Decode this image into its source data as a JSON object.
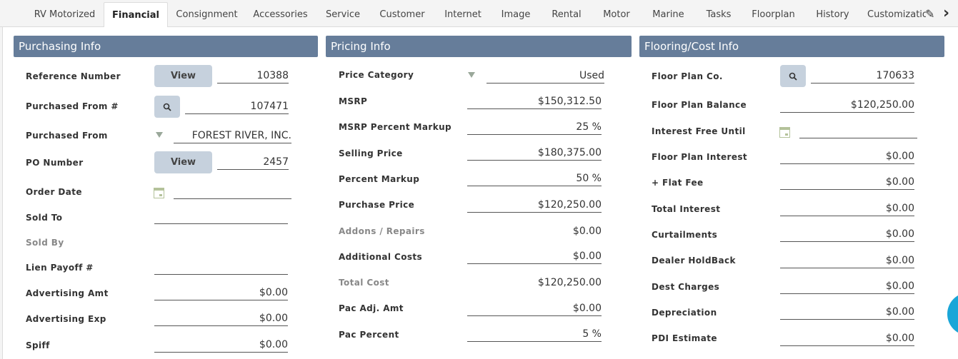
{
  "tabs": [
    {
      "label": "RV Motorized"
    },
    {
      "label": "Financial"
    },
    {
      "label": "Consignment"
    },
    {
      "label": "Accessories"
    },
    {
      "label": "Service"
    },
    {
      "label": "Customer"
    },
    {
      "label": "Internet"
    },
    {
      "label": "Image"
    },
    {
      "label": "Rental"
    },
    {
      "label": "Motor"
    },
    {
      "label": "Marine"
    },
    {
      "label": "Tasks"
    },
    {
      "label": "Floorplan"
    },
    {
      "label": "History"
    },
    {
      "label": "Customization"
    }
  ],
  "tab_tools": {
    "edit_icon": "✎",
    "next_icon": "›"
  },
  "purchasing": {
    "title": "Purchasing Info",
    "reference_number": {
      "label": "Reference Number",
      "button": "View",
      "value": "10388"
    },
    "purchased_from_num": {
      "label": "Purchased From #",
      "button_icon": "search-icon",
      "value": "107471"
    },
    "purchased_from": {
      "label": "Purchased From",
      "value": "FOREST RIVER, INC."
    },
    "po_number": {
      "label": "PO Number",
      "button": "View",
      "value": "2457"
    },
    "order_date": {
      "label": "Order Date",
      "value": ""
    },
    "sold_to": {
      "label": "Sold To",
      "value": ""
    },
    "sold_by": {
      "label": "Sold By"
    },
    "lien_payoff": {
      "label": "Lien Payoff #",
      "value": ""
    },
    "advertising_amt": {
      "label": "Advertising Amt",
      "value": "$0.00"
    },
    "advertising_exp": {
      "label": "Advertising Exp",
      "value": "$0.00"
    },
    "spiff": {
      "label": "Spiff",
      "value": "$0.00"
    }
  },
  "pricing": {
    "title": "Pricing Info",
    "price_category": {
      "label": "Price Category",
      "value": "Used"
    },
    "msrp": {
      "label": "MSRP",
      "value": "$150,312.50"
    },
    "msrp_percent_markup": {
      "label": "MSRP Percent Markup",
      "value": "25 %"
    },
    "selling_price": {
      "label": "Selling Price",
      "value": "$180,375.00"
    },
    "percent_markup": {
      "label": "Percent Markup",
      "value": "50 %"
    },
    "purchase_price": {
      "label": "Purchase Price",
      "value": "$120,250.00"
    },
    "addons_repairs": {
      "label": "Addons / Repairs",
      "value": "$0.00"
    },
    "additional_costs": {
      "label": "Additional Costs",
      "value": "$0.00"
    },
    "total_cost": {
      "label": "Total Cost",
      "value": "$120,250.00"
    },
    "pac_adj_amt": {
      "label": "Pac Adj. Amt",
      "value": "$0.00"
    },
    "pac_percent": {
      "label": "Pac Percent",
      "value": "5 %"
    }
  },
  "flooring": {
    "title": "Flooring/Cost Info",
    "floor_plan_co": {
      "label": "Floor Plan Co.",
      "value": "170633"
    },
    "floor_plan_balance": {
      "label": "Floor Plan Balance",
      "value": "$120,250.00"
    },
    "interest_free_until": {
      "label": "Interest Free Until",
      "value": ""
    },
    "floor_plan_interest": {
      "label": "Floor Plan Interest",
      "value": "$0.00"
    },
    "flat_fee": {
      "label": "+ Flat Fee",
      "value": "$0.00"
    },
    "total_interest": {
      "label": "Total Interest",
      "value": "$0.00"
    },
    "curtailments": {
      "label": "Curtailments",
      "value": "$0.00"
    },
    "dealer_holdback": {
      "label": "Dealer HoldBack",
      "value": "$0.00"
    },
    "dest_charges": {
      "label": "Dest Charges",
      "value": "$0.00"
    },
    "depreciation": {
      "label": "Depreciation",
      "value": "$0.00"
    },
    "pdi_estimate": {
      "label": "PDI Estimate",
      "value": "$0.00"
    }
  },
  "colors": {
    "section_header": "#667d9a",
    "button": "#c6d1dd",
    "fab": "#1aa6d8"
  }
}
